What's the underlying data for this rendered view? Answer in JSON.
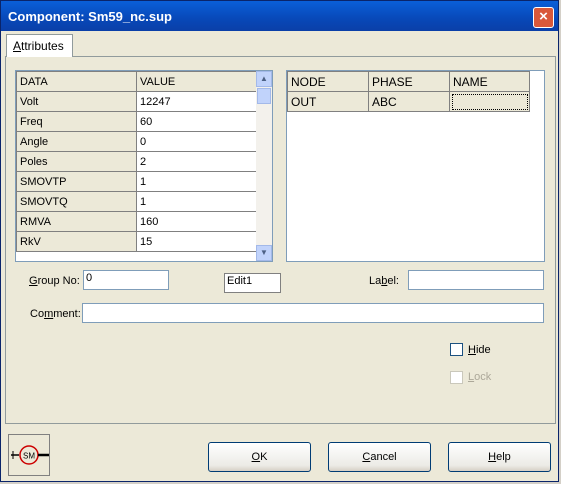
{
  "window": {
    "title": "Component: Sm59_nc.sup",
    "close_label": "×"
  },
  "tabs": [
    {
      "prefix": "A",
      "rest": "ttributes"
    }
  ],
  "attributes_grid": {
    "headers": [
      "DATA",
      "VALUE"
    ],
    "rows": [
      {
        "data": "Volt",
        "value": "12247"
      },
      {
        "data": "Freq",
        "value": "60"
      },
      {
        "data": "Angle",
        "value": "0"
      },
      {
        "data": "Poles",
        "value": "2"
      },
      {
        "data": "SMOVTP",
        "value": "1"
      },
      {
        "data": "SMOVTQ",
        "value": "1"
      },
      {
        "data": "RMVA",
        "value": "160"
      },
      {
        "data": "RkV",
        "value": "15"
      }
    ]
  },
  "node_grid": {
    "headers": [
      "NODE",
      "PHASE",
      "NAME"
    ],
    "rows": [
      {
        "node": "OUT",
        "phase": "ABC",
        "name": ""
      }
    ]
  },
  "form": {
    "group_no": {
      "label_prefix": "G",
      "label_rest": "roup No:",
      "value": "0"
    },
    "edit1": {
      "value": "Edit1"
    },
    "label": {
      "label_pre": "La",
      "label_u": "b",
      "label_post": "el:",
      "value": ""
    },
    "comment": {
      "label_pre": "Co",
      "label_u": "m",
      "label_post": "ment:",
      "value": ""
    },
    "hide": {
      "label_u": "H",
      "label_rest": "ide",
      "checked": false
    },
    "lock": {
      "label_u": "L",
      "label_rest": "ock",
      "checked": false,
      "disabled": true
    }
  },
  "buttons": {
    "ok": {
      "u": "O",
      "rest": "K"
    },
    "cancel": {
      "u": "C",
      "rest": "ancel"
    },
    "help": {
      "u": "H",
      "rest": "elp"
    }
  },
  "component_icon": {
    "name": "synchronous-machine-icon",
    "text": "SM"
  },
  "colors": {
    "titlebar": "#0a5fd8",
    "close": "#d9583a",
    "dialog_bg": "#ece9d8"
  }
}
